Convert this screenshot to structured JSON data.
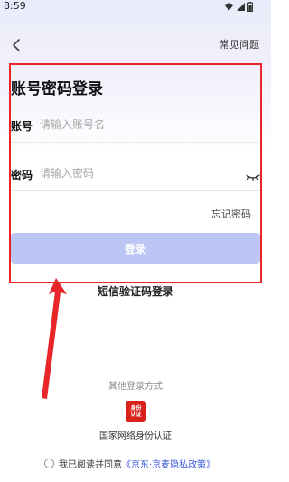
{
  "status_bar": {
    "time": "8:59"
  },
  "header": {
    "faq_label": "常见问题"
  },
  "title": "账号密码登录",
  "account": {
    "label": "账号",
    "placeholder": "请输入账号名"
  },
  "password": {
    "label": "密码",
    "placeholder": "请输入密码"
  },
  "forgot_label": "忘记密码",
  "login_label": "登录",
  "sms_login_label": "短信验证码登录",
  "other_methods_label": "其他登录方式",
  "gov_id": {
    "icon_text_top": "身份",
    "icon_text_bottom": "认证",
    "label": "国家网络身份认证"
  },
  "agreement": {
    "prefix": "我已阅读并同意",
    "link": "《京东·京麦隐私政策》"
  },
  "colors": {
    "accent": "#3d5bd9",
    "login_button": "#bcc6f4",
    "annotation": "#e8262a",
    "gov_icon": "#d8221c"
  }
}
